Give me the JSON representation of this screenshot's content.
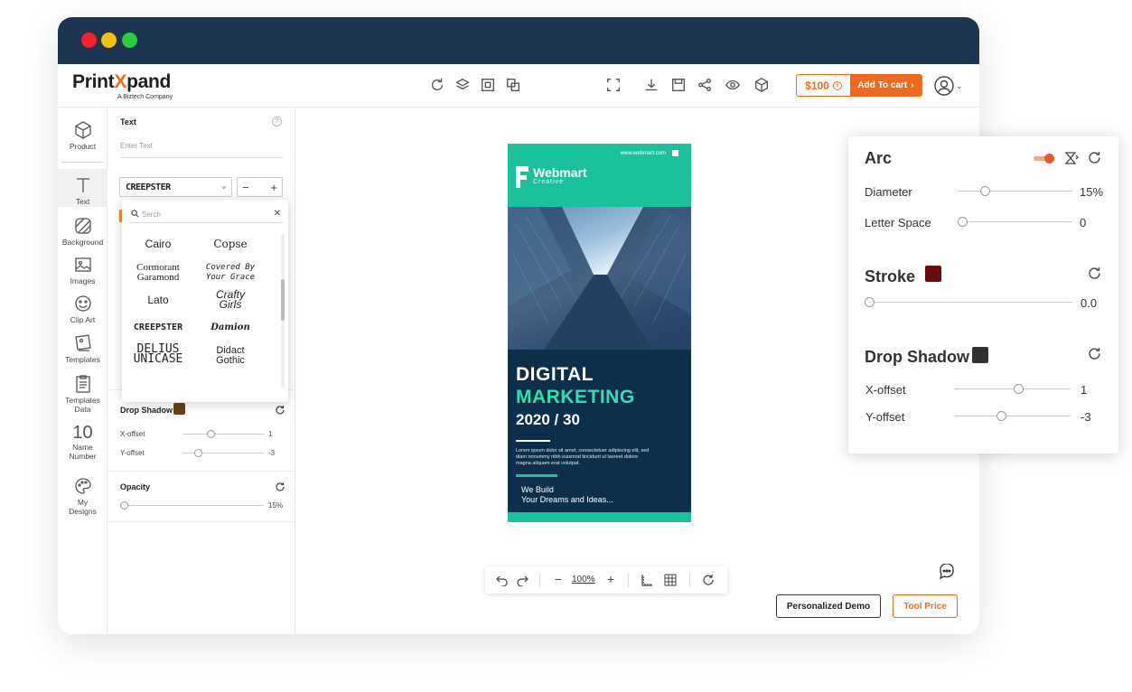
{
  "app": {
    "logo_main_a": "Print",
    "logo_main_x": "X",
    "logo_main_b": "pand",
    "logo_sub": "A Biztech Company"
  },
  "toolbar": {
    "price": "$100",
    "add_to_cart": "Add To cart"
  },
  "sidebar": {
    "items": [
      {
        "label": "Product",
        "icon": "cube-icon"
      },
      {
        "label": "Text",
        "icon": "text-icon"
      },
      {
        "label": "Background",
        "icon": "background-icon"
      },
      {
        "label": "Images",
        "icon": "image-icon"
      },
      {
        "label": "Clip Art",
        "icon": "smiley-icon"
      },
      {
        "label": "Templates",
        "icon": "templates-icon"
      },
      {
        "label": "Templates Data",
        "icon": "clipboard-icon"
      },
      {
        "label": "Name Number",
        "icon": "number-icon"
      },
      {
        "label": "My Designs",
        "icon": "palette-icon"
      }
    ],
    "number_glyph": "10"
  },
  "text_panel": {
    "title": "Text",
    "placeholder": "Enter Text",
    "font_selected": "CREEPSTER",
    "drop_shadow": {
      "label": "Drop Shadow",
      "color": "#6b3f17",
      "x_label": "X-offset",
      "x_value": "1",
      "y_label": "Y-offset",
      "y_value": "-3"
    },
    "opacity": {
      "label": "Opacity",
      "value": "15%"
    }
  },
  "font_dropdown": {
    "search_placeholder": "Serch",
    "fonts": [
      {
        "line1": "Cairo",
        "line2": ""
      },
      {
        "line1": "Copse",
        "line2": ""
      },
      {
        "line1": "Cormorant",
        "line2": "Garamond"
      },
      {
        "line1": "Covered By",
        "line2": "Your Grace"
      },
      {
        "line1": "Lato",
        "line2": ""
      },
      {
        "line1": "Crafty",
        "line2": "Girls"
      },
      {
        "line1": "CREEPSTER",
        "line2": ""
      },
      {
        "line1": "Damion",
        "line2": ""
      },
      {
        "line1": "DELIUS",
        "line2": "UNICASE"
      },
      {
        "line1": "Didact",
        "line2": "Gothic"
      }
    ]
  },
  "poster": {
    "url": "www.webmart.com",
    "brand": "Webmart",
    "brand_sub": "Creative",
    "headline1": "DIGITAL",
    "headline2": "MARKETING",
    "headline3": "2020 / 30",
    "body": "Lorem ipsum dolor sit amet, consectetuer adipiscing elit, sed diam nonummy nibh euismod tincidunt ut laoreet dolore magna aliquam erat volutpat.",
    "tag1": "We Build",
    "tag2": "Your Dreams and Ideas..."
  },
  "zoom": {
    "level": "100%"
  },
  "buttons": {
    "demo": "Personalized Demo",
    "tool_price": "Tool Price"
  },
  "arc_panel": {
    "arc_title": "Arc",
    "diameter_label": "Diameter",
    "diameter_value": "15%",
    "letter_space_label": "Letter Space",
    "letter_space_value": "0",
    "stroke_title": "Stroke",
    "stroke_color": "#6b0c0c",
    "stroke_value": "0.0",
    "shadow_title": "Drop Shadow",
    "shadow_color": "#333333",
    "x_label": "X-offset",
    "x_value": "1",
    "y_label": "Y-offset",
    "y_value": "-3"
  },
  "colors": {
    "accent": "#ef6a1f",
    "titlebar": "#1c3550",
    "poster_green": "#19c29a",
    "poster_navy": "#0e2f4a"
  }
}
